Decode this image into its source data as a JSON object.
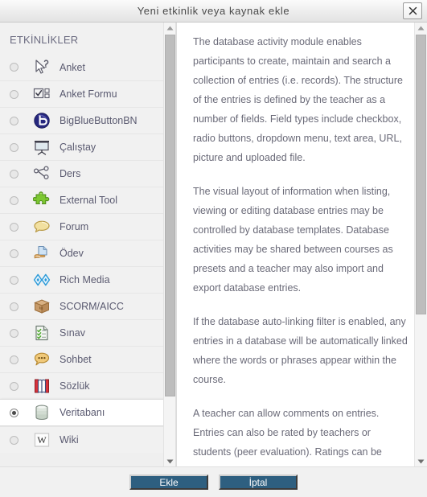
{
  "window": {
    "title": "Yeni etkinlik veya kaynak ekle",
    "close_icon": "close-icon"
  },
  "sidebar": {
    "heading": "ETKİNLİKLER",
    "items": [
      {
        "label": "Anket",
        "icon": "cursor-question-icon",
        "selected": false
      },
      {
        "label": "Anket Formu",
        "icon": "checkbox-form-icon",
        "selected": false
      },
      {
        "label": "BigBlueButtonBN",
        "icon": "bigbluebutton-icon",
        "selected": false
      },
      {
        "label": "Çalıştay",
        "icon": "presentation-board-icon",
        "selected": false
      },
      {
        "label": "Ders",
        "icon": "lesson-nodes-icon",
        "selected": false
      },
      {
        "label": "External Tool",
        "icon": "puzzle-piece-icon",
        "selected": false
      },
      {
        "label": "Forum",
        "icon": "speech-bubble-icon",
        "selected": false
      },
      {
        "label": "Ödev",
        "icon": "hand-document-icon",
        "selected": false
      },
      {
        "label": "Rich Media",
        "icon": "diamonds-icon",
        "selected": false
      },
      {
        "label": "SCORM/AICC",
        "icon": "package-box-icon",
        "selected": false
      },
      {
        "label": "Sınav",
        "icon": "checklist-icon",
        "selected": false
      },
      {
        "label": "Sohbet",
        "icon": "chat-bubble-icon",
        "selected": false
      },
      {
        "label": "Sözlük",
        "icon": "open-book-icon",
        "selected": false
      },
      {
        "label": "Veritabanı",
        "icon": "database-icon",
        "selected": true
      },
      {
        "label": "Wiki",
        "icon": "wiki-w-icon",
        "selected": false
      }
    ]
  },
  "description": {
    "paragraphs": [
      "The database activity module enables participants to create, maintain and search a collection of entries (i.e. records). The structure of the entries is defined by the teacher as a number of fields. Field types include checkbox, radio buttons, dropdown menu, text area, URL, picture and uploaded file.",
      "The visual layout of information when listing, viewing or editing database entries may be controlled by database templates. Database activities may be shared between courses as presets and a teacher may also import and export database entries.",
      "If the database auto-linking filter is enabled, any entries in a database will be automatically linked where the words or phrases appear within the course.",
      "A teacher can allow comments on entries. Entries can also be rated by teachers or students (peer evaluation). Ratings can be"
    ]
  },
  "footer": {
    "submit_label": "Ekle",
    "cancel_label": "İptal"
  },
  "colors": {
    "button_bg": "#2e5f80",
    "title_text": "#4a4a4a",
    "body_text": "#6a6a78",
    "selected_row_bg": "#ffffff",
    "panel_bg": "#f1f1f1"
  }
}
